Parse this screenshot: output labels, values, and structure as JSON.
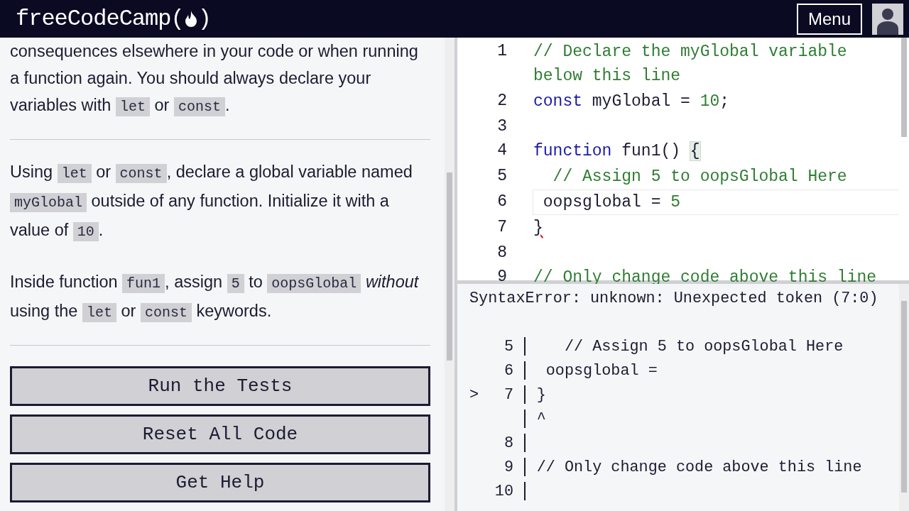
{
  "header": {
    "logo_text": "freeCodeCamp(",
    "logo_close": ")",
    "menu_button": "Menu"
  },
  "instructions": {
    "paragraphs": [
      {
        "parts": [
          {
            "kind": "text",
            "text": "consequences elsewhere in your code or when running a function again. You should always declare your variables with "
          },
          {
            "kind": "code",
            "text": "let"
          },
          {
            "kind": "text",
            "text": " or "
          },
          {
            "kind": "code",
            "text": "const"
          },
          {
            "kind": "text",
            "text": "."
          }
        ]
      },
      {
        "parts": [
          {
            "kind": "text",
            "text": "Using "
          },
          {
            "kind": "code",
            "text": "let"
          },
          {
            "kind": "text",
            "text": " or "
          },
          {
            "kind": "code",
            "text": "const"
          },
          {
            "kind": "text",
            "text": ", declare a global variable named "
          },
          {
            "kind": "code",
            "text": "myGlobal"
          },
          {
            "kind": "text",
            "text": " outside of any function. Initialize it with a value of "
          },
          {
            "kind": "code",
            "text": "10"
          },
          {
            "kind": "text",
            "text": "."
          }
        ]
      },
      {
        "parts": [
          {
            "kind": "text",
            "text": "Inside function "
          },
          {
            "kind": "code",
            "text": "fun1"
          },
          {
            "kind": "text",
            "text": ", assign "
          },
          {
            "kind": "code",
            "text": "5"
          },
          {
            "kind": "text",
            "text": " to "
          },
          {
            "kind": "code",
            "text": "oopsGlobal"
          },
          {
            "kind": "text",
            "text": " *without* using the "
          },
          {
            "kind": "code",
            "text": "let"
          },
          {
            "kind": "text",
            "text": " or "
          },
          {
            "kind": "code",
            "text": "const"
          },
          {
            "kind": "text",
            "text": " keywords."
          }
        ]
      }
    ],
    "buttons": [
      "Run the Tests",
      "Reset All Code",
      "Get Help"
    ]
  },
  "editor": {
    "lines": [
      {
        "number": "1",
        "active": false,
        "tokens": [
          {
            "kind": "comment",
            "text": "// Declare the myGlobal variable below this line"
          }
        ]
      },
      {
        "number": "2",
        "active": false,
        "tokens": [
          {
            "kind": "keyword",
            "text": "const"
          },
          {
            "kind": "plain",
            "text": " myGlobal = "
          },
          {
            "kind": "number",
            "text": "10"
          },
          {
            "kind": "plain",
            "text": ";"
          }
        ]
      },
      {
        "number": "3",
        "active": false
      },
      {
        "number": "4",
        "active": false,
        "tokens": [
          {
            "kind": "keyword",
            "text": "function"
          },
          {
            "kind": "plain",
            "text": " fun1() "
          },
          {
            "kind": "match",
            "text": "{"
          }
        ]
      },
      {
        "number": "5",
        "active": false,
        "tokens": [
          {
            "kind": "comment",
            "text": "  // Assign 5 to oopsGlobal Here"
          }
        ]
      },
      {
        "number": "6",
        "active": true,
        "tokens": [
          {
            "kind": "plain",
            "text": " oopsglobal = "
          },
          {
            "kind": "number",
            "text": "5"
          }
        ]
      },
      {
        "number": "7",
        "active": false,
        "tokens": [
          {
            "kind": "error",
            "text": "}"
          }
        ]
      },
      {
        "number": "8",
        "active": false
      },
      {
        "number": "9",
        "active": false,
        "tokens": [
          {
            "kind": "comment",
            "text": "// Only change code above this line"
          }
        ]
      }
    ]
  },
  "console": {
    "message": "SyntaxError: unknown: Unexpected token (7:0)",
    "frame": [
      {
        "number": "5",
        "code": "   // Assign 5 to oopsGlobal Here"
      },
      {
        "number": "6",
        "code": " oopsglobal ="
      },
      {
        "marker": ">",
        "number": "7",
        "code": "}"
      },
      {
        "code": "^"
      },
      {
        "number": "8"
      },
      {
        "number": "9",
        "code": "// Only change code above this line"
      },
      {
        "number": "10"
      }
    ]
  }
}
